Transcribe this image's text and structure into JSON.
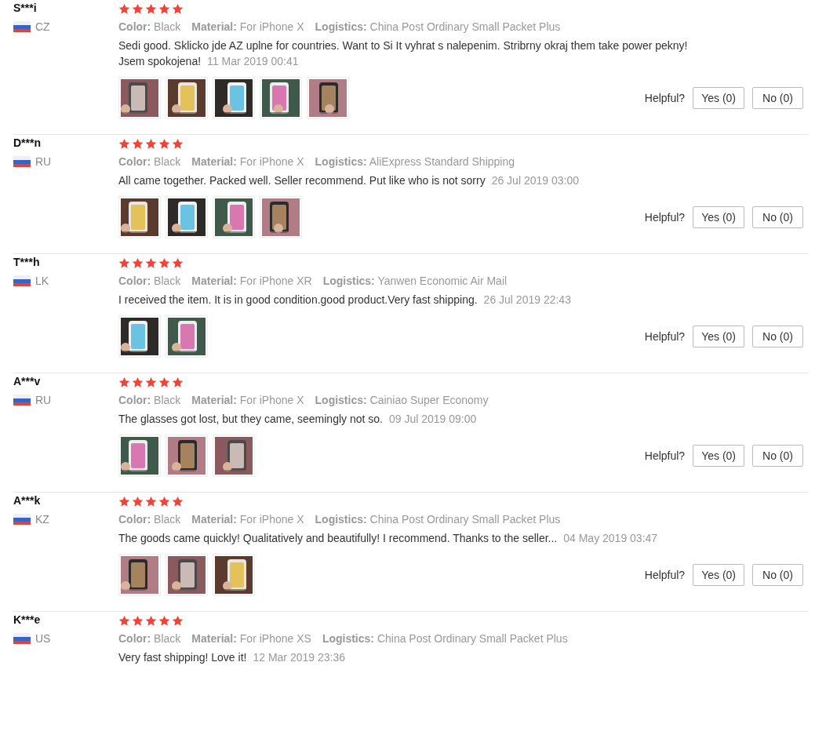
{
  "reviews": [
    {
      "name": "S***i",
      "country": "CZ",
      "stars": 5,
      "attributes": [
        {
          "label": "Color:",
          "value": "Black"
        },
        {
          "label": "Material:",
          "value": "For iPhone X"
        },
        {
          "label": "Logistics:",
          "value": "China Post Ordinary Small Packet Plus"
        }
      ],
      "text_lines": [
        "Sedi good. Sklicko jde AZ uplne for countries. Want to Si It vyhrat s nalepenim. Stribrny okraj them take power pekny!",
        "Jsem spokojena!"
      ],
      "date": "11 Mar 2019 00:41",
      "photos": [
        {
          "kind": "picture"
        },
        {
          "kind": "picture"
        },
        {
          "kind": "picture"
        },
        {
          "kind": "picture"
        },
        {
          "kind": "picture"
        }
      ],
      "helpful": {
        "label": "Helpful?",
        "yes": "Yes (0)",
        "no": "No (0)"
      }
    },
    {
      "name": "D***n",
      "country": "RU",
      "stars": 5,
      "attributes": [
        {
          "label": "Color:",
          "value": "Black"
        },
        {
          "label": "Material:",
          "value": "For iPhone X"
        },
        {
          "label": "Logistics:",
          "value": "AliExpress Standard Shipping"
        }
      ],
      "text_lines": [
        "All came together. Packed well. Seller recommend. Put like who is not sorry"
      ],
      "date": "26 Jul 2019 03:00",
      "photos": [
        {
          "kind": "picture"
        },
        {
          "kind": "picture"
        },
        {
          "kind": "picture"
        },
        {
          "kind": "picture"
        }
      ],
      "helpful": {
        "label": "Helpful?",
        "yes": "Yes (0)",
        "no": "No (0)"
      }
    },
    {
      "name": "T***h",
      "country": "LK",
      "stars": 5,
      "attributes": [
        {
          "label": "Color:",
          "value": "Black"
        },
        {
          "label": "Material:",
          "value": "For iPhone XR"
        },
        {
          "label": "Logistics:",
          "value": "Yanwen Economic Air Mail"
        }
      ],
      "text_lines": [
        "I received the item. It is in good condition.good product.Very fast shipping."
      ],
      "date": "26 Jul 2019 22:43",
      "photos": [
        {
          "kind": "picture"
        },
        {
          "kind": "picture"
        }
      ],
      "helpful": {
        "label": "Helpful?",
        "yes": "Yes (0)",
        "no": "No (0)"
      }
    },
    {
      "name": "A***v",
      "country": "RU",
      "stars": 5,
      "attributes": [
        {
          "label": "Color:",
          "value": "Black"
        },
        {
          "label": "Material:",
          "value": "For iPhone X"
        },
        {
          "label": "Logistics:",
          "value": "Cainiao Super Economy"
        }
      ],
      "text_lines": [
        "The glasses got lost, but they came, seemingly not so."
      ],
      "date": "09 Jul 2019 09:00",
      "photos": [
        {
          "kind": "picture"
        },
        {
          "kind": "picture"
        },
        {
          "kind": "picture"
        }
      ],
      "helpful": {
        "label": "Helpful?",
        "yes": "Yes (0)",
        "no": "No (0)"
      }
    },
    {
      "name": "A***k",
      "country": "KZ",
      "stars": 5,
      "attributes": [
        {
          "label": "Color:",
          "value": "Black"
        },
        {
          "label": "Material:",
          "value": "For iPhone X"
        },
        {
          "label": "Logistics:",
          "value": "China Post Ordinary Small Packet Plus"
        }
      ],
      "text_lines": [
        "The goods came quickly! Qualitatively and beautifully! I recommend. Thanks to the seller..."
      ],
      "date": "04 May 2019 03:47",
      "photos": [
        {
          "kind": "picture"
        },
        {
          "kind": "picture"
        },
        {
          "kind": "picture"
        }
      ],
      "helpful": {
        "label": "Helpful?",
        "yes": "Yes (0)",
        "no": "No (0)"
      }
    },
    {
      "name": "K***e",
      "country": "US",
      "stars": 5,
      "attributes": [
        {
          "label": "Color:",
          "value": "Black"
        },
        {
          "label": "Material:",
          "value": "For iPhone XS"
        },
        {
          "label": "Logistics:",
          "value": "China Post Ordinary Small Packet Plus"
        }
      ],
      "text_lines": [
        "Very fast shipping! Love it!"
      ],
      "date": "12 Mar 2019 23:36"
    }
  ]
}
